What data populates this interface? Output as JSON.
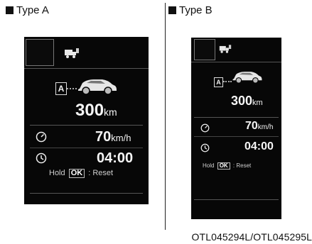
{
  "type_a_label": "Type A",
  "type_b_label": "Type B",
  "caption": "OTL045294L/OTL045295L",
  "screen": {
    "mode_badge": "A",
    "range_value": "300",
    "range_unit": "km",
    "speed_value": "70",
    "speed_unit": "km/h",
    "time_value": "04:00",
    "hold_text": "Hold",
    "ok_text": "OK",
    "reset_text": ": Reset"
  },
  "icons": {
    "square": "filled-square-icon",
    "fuel_truck": "fuel-truck-icon",
    "car": "car-icon",
    "speedometer": "speedometer-icon",
    "clock": "clock-icon"
  },
  "colors": {
    "screen_bg": "#070707",
    "text": "#f5f5f5",
    "divider": "#555555"
  }
}
